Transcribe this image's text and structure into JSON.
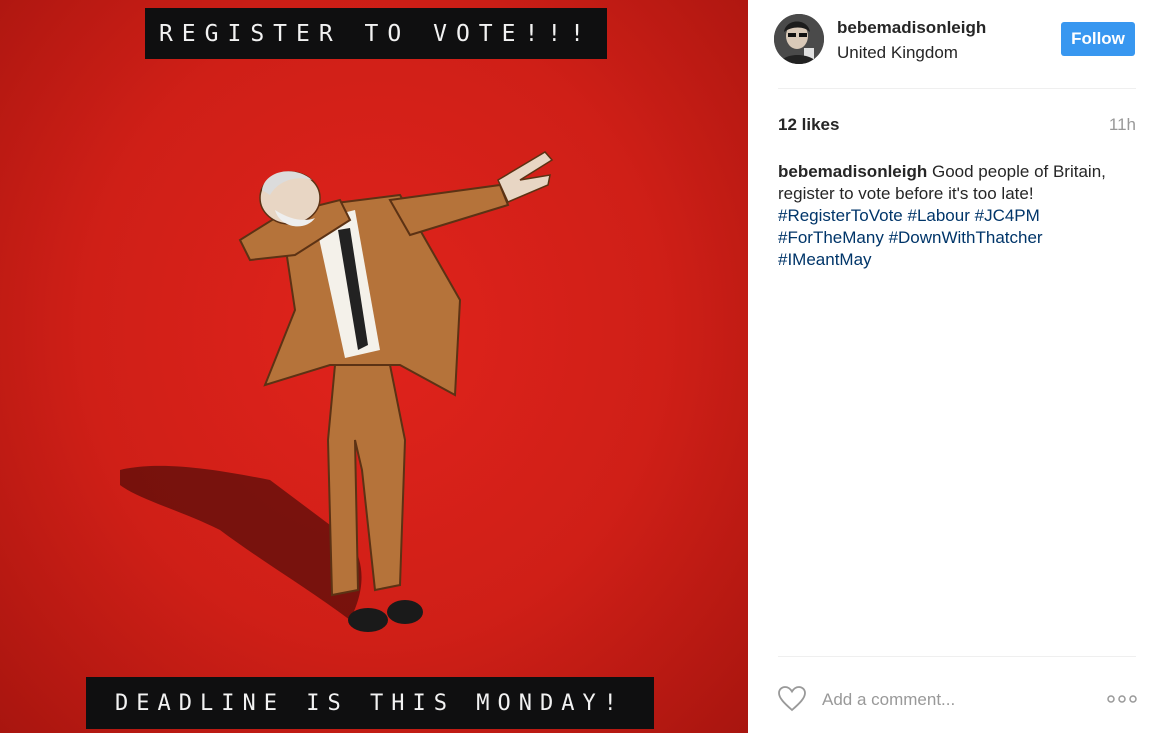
{
  "post_image": {
    "top_banner": "REGISTER TO VOTE!!!",
    "bottom_banner": "DEADLINE IS THIS MONDAY!",
    "background_color": "#d9221a"
  },
  "header": {
    "username": "bebemadisonleigh",
    "location": "United Kingdom",
    "follow_label": "Follow",
    "follow_color": "#3897f0"
  },
  "stats": {
    "likes": "12 likes",
    "time": "11h"
  },
  "caption": {
    "username": "bebemadisonleigh",
    "text": "Good people of Britain, register to vote before it's too late!",
    "hashtags": [
      "#RegisterToVote",
      "#Labour",
      "#JC4PM",
      "#ForTheMany",
      "#DownWithThatcher",
      "#IMeantMay"
    ]
  },
  "comment": {
    "placeholder": "Add a comment...",
    "like_icon": "heart-icon",
    "more_icon": "more-options-icon"
  }
}
